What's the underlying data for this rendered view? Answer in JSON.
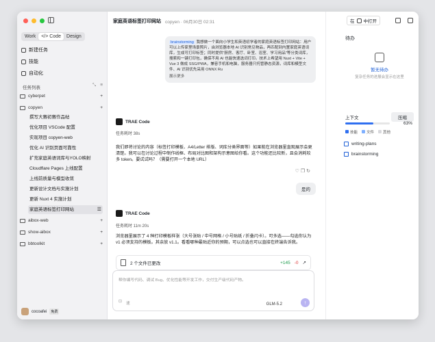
{
  "colors": {
    "accent": "#2f6ff0",
    "red": "#ff5f57",
    "yellow": "#febc2e",
    "green": "#28c840"
  },
  "sidebar": {
    "modes": [
      "Work",
      "</> Code",
      "Design"
    ],
    "nav": [
      {
        "label": "新建任务",
        "icon": "plus-square-icon"
      },
      {
        "label": "技能",
        "icon": "skill-icon"
      },
      {
        "label": "自动化",
        "icon": "clock-icon"
      }
    ],
    "section": "任务列表",
    "folders": [
      {
        "name": "cyberpet",
        "tasks": []
      },
      {
        "name": "copyen",
        "tasks": [
          "撰写大赛初赛作品帖",
          "优化项目 VSCode 配置",
          "实现项目 copyen-web",
          "优化 AI 识别页面可靠性",
          "扩充家庭英语词库与YOLO映射",
          "Cloudflare Pages 上线配置",
          "上线前质量与模型收敛",
          "更新设计文档与实施计划",
          "更新 Nuxt 4 实施计划",
          "家庭英语标签打印网站"
        ]
      },
      {
        "name": "aibox-web",
        "tasks": []
      },
      {
        "name": "show-aibox",
        "tasks": []
      },
      {
        "name": "bbtoolkit",
        "tasks": []
      }
    ],
    "user": {
      "name": "cocoafei",
      "badge": "免费"
    }
  },
  "header": {
    "title": "家庭英语标签打印网站",
    "meta": "copyen · 06月30日 02:31",
    "open_in": "在",
    "open_app": "中打开"
  },
  "chat": {
    "user_chip": "brainstorming",
    "user_msg": "我想做一个面向小学生和英语初学者的家庭英语标签打印网站：用户可以上传家里场景照片，由浏览器本地 AI 识别常见物品，再匹配到内置家庭英语词库，生成可打印标签；同时提供\"厨房、客厅、卧室、浴室、学习用品\"等分类词库，搜索和一键打印包，确保不用 AI 也能快速选词打印。技术上希望用 Nuxt + Vite + Vue 3 做成 SSG/PWA，兼容手机和电脑，服务器只托管静态资源，词库和模型文件、AI 识别优先采用 ONNX Ru",
    "show_more": "展示更多",
    "agent_name": "TRAE Code",
    "task_time1": "任务耗时 38s",
    "reply1": "我们即将讨论的内容（标签打印模板、A4/Letter 排版、词库分类界面等）如果能在浏览器里直观展示会更清楚。我可以在讨论过程中制作线框、布局对比图和架构示意图给你看。这个功能还比较新，且会消耗较多 token。要试试吗？（需要打开一个本地 URL）",
    "user_short": "是的",
    "task_time2": "任务耗时 11m 20s",
    "reply2": "浏览器里展示了 4 种打印模板样张（大号张贴 / 中号网格 / 小号贴纸 / 折叠闪卡）。可多选——勾选你认为 v1 必须支持的模板。其余放 v1.1。看看哪种最贴近你的预期，可以点选也可以直接在终端告诉我。",
    "changes_label": "2 个文件已更改",
    "added": "+145",
    "removed": "-0"
  },
  "composer": {
    "placeholder": "帮你编写代码、调试 Bug、优化性能等开发工作，交付生产级代码产物。",
    "model": "GLM-5.2",
    "fast": "速",
    "attach_icon": "attach-icon"
  },
  "right": {
    "title": "待办",
    "empty_title": "暂无待办",
    "empty_desc": "复杂任务的进展会显示在这里",
    "context_label": "上下文",
    "compress": "压缩",
    "context_pct": "63%",
    "context_frac": 0.63,
    "legend": [
      "技能",
      "文件",
      "其他"
    ],
    "items": [
      "writing-plans",
      "brainstorming"
    ]
  }
}
